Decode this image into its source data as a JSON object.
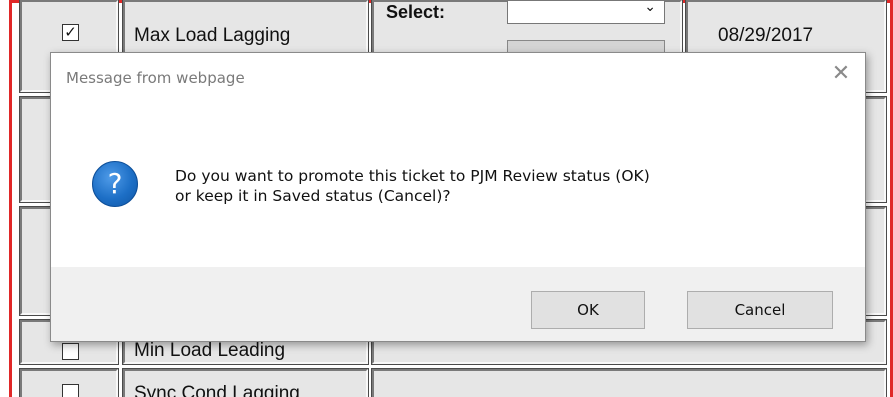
{
  "background_table": {
    "rows": [
      {
        "label": "Max Load Lagging",
        "checked": true,
        "check_glyph": "✓"
      },
      {
        "label": "Min Load Leading",
        "checked": false,
        "check_glyph": ""
      },
      {
        "label": "Sync Cond Lagging",
        "checked": false,
        "check_glyph": ""
      }
    ],
    "select_label": "Select:",
    "date": "08/29/2017",
    "chevron_glyph": "⌄"
  },
  "dialog": {
    "title": "Message from webpage",
    "close_glyph": "✕",
    "icon_glyph": "?",
    "message_line1": "Do you want to promote this ticket to PJM Review status (OK)",
    "message_line2": "or keep it in Saved status (Cancel)?",
    "buttons": {
      "ok": "OK",
      "cancel": "Cancel"
    }
  },
  "colors": {
    "frame": "#e02828",
    "dialog_footer": "#f0f0f0",
    "icon_blue": "#1d6fc6"
  }
}
